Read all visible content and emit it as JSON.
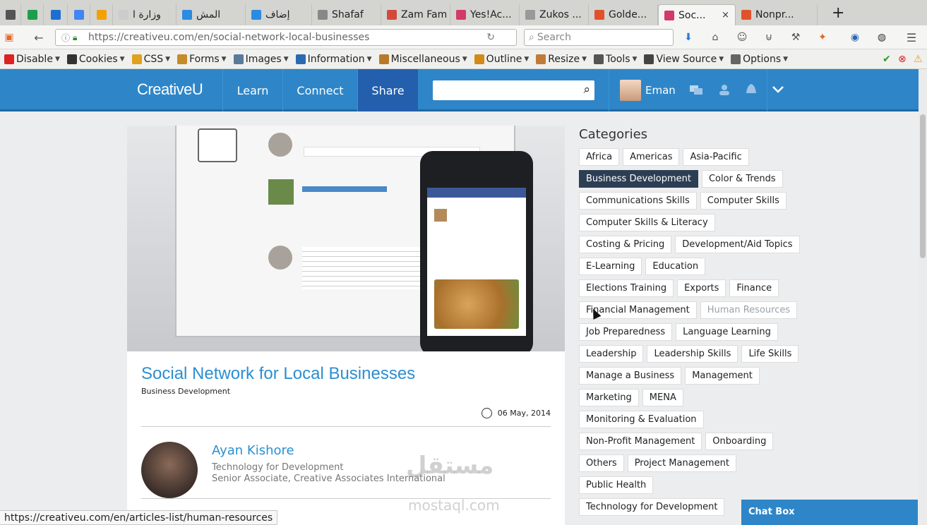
{
  "browser": {
    "tabs": [
      {
        "label": "",
        "color": "#555555"
      },
      {
        "label": "",
        "color": "#1e9e4a"
      },
      {
        "label": "",
        "color": "#1d6fd1"
      },
      {
        "label": "",
        "color": "#4285f4"
      },
      {
        "label": "",
        "color": "#f2a100"
      },
      {
        "label": "وزارة ا",
        "color": "#cccccc"
      },
      {
        "label": "المش",
        "color": "#2a8be0"
      },
      {
        "label": "إضاف",
        "color": "#2a8be0"
      },
      {
        "label": "Shafaf",
        "color": "#888888"
      },
      {
        "label": "Zam Fam",
        "color": "#d34a3a"
      },
      {
        "label": "Yes!Ac...",
        "color": "#d33a6a"
      },
      {
        "label": "Zukos ...",
        "color": "#999999"
      },
      {
        "label": "Golde...",
        "color": "#e2522a"
      },
      {
        "label": "Soc...",
        "color": "#d33a6a"
      },
      {
        "label": "Nonpr...",
        "color": "#e2522a"
      }
    ],
    "active_tab_close": "×",
    "url": "https://creativeu.com/en/social-network-local-businesses",
    "search_placeholder": "Search",
    "status_url": "https://creativeu.com/en/articles-list/human-resources"
  },
  "webdev_toolbar": {
    "items": [
      "Disable",
      "Cookies",
      "CSS",
      "Forms",
      "Images",
      "Information",
      "Miscellaneous",
      "Outline",
      "Resize",
      "Tools",
      "View Source",
      "Options"
    ]
  },
  "site": {
    "logo": "CreativeU",
    "menu": [
      "Learn",
      "Connect",
      "Share"
    ],
    "user_name": "Eman",
    "accent_color": "#2e86c8"
  },
  "article": {
    "title": "Social Network for Local Businesses",
    "category": "Business Development",
    "date": "06 May, 2014",
    "author_name": "Ayan Kishore",
    "author_line1": "Technology for Development",
    "author_line2": "Senior Associate, Creative Associates International"
  },
  "categories": {
    "title": "Categories",
    "rows": [
      [
        "Africa",
        "Americas",
        "Asia-Pacific"
      ],
      [
        "Business Development",
        "Color & Trends"
      ],
      [
        "Communications Skills",
        "Computer Skills"
      ],
      [
        "Computer Skills & Literacy"
      ],
      [
        "Costing & Pricing",
        "Development/Aid Topics"
      ],
      [
        "E-Learning",
        "Education"
      ],
      [
        "Elections Training",
        "Exports",
        "Finance"
      ],
      [
        "Financial Management",
        "Human Resources"
      ],
      [
        "Job Preparedness",
        "Language Learning"
      ],
      [
        "Leadership",
        "Leadership Skills",
        "Life Skills"
      ],
      [
        "Manage a Business",
        "Management"
      ],
      [
        "Marketing",
        "MENA"
      ],
      [
        "Monitoring & Evaluation"
      ],
      [
        "Non-Profit Management",
        "Onboarding"
      ],
      [
        "Others",
        "Project Management"
      ],
      [
        "Public Health"
      ],
      [
        "Technology for Development"
      ]
    ],
    "selected": "Business Development",
    "hovered": "Human Resources"
  },
  "chat": {
    "label": "Chat Box"
  },
  "watermark": {
    "line1": "مستقل",
    "line2": "mostaql.com"
  }
}
